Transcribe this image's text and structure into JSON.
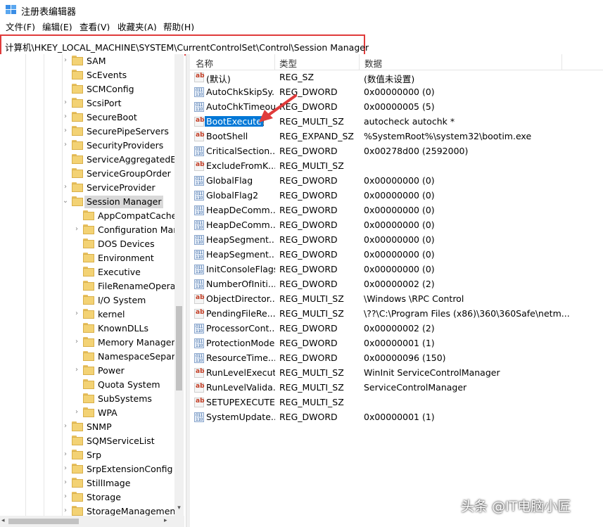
{
  "window": {
    "title": "注册表编辑器",
    "icon": "regedit-icon"
  },
  "menu": [
    {
      "label": "文件(F)"
    },
    {
      "label": "编辑(E)"
    },
    {
      "label": "查看(V)"
    },
    {
      "label": "收藏夹(A)"
    },
    {
      "label": "帮助(H)"
    }
  ],
  "address": {
    "path": "计算机\\HKEY_LOCAL_MACHINE\\SYSTEM\\CurrentControlSet\\Control\\Session Manager",
    "highlight_color": "#e03b3b"
  },
  "tree": {
    "items": [
      {
        "label": "SAM",
        "level": 0,
        "expander": ">"
      },
      {
        "label": "ScEvents",
        "level": 0,
        "expander": ""
      },
      {
        "label": "SCMConfig",
        "level": 0,
        "expander": ""
      },
      {
        "label": "ScsiPort",
        "level": 0,
        "expander": ">"
      },
      {
        "label": "SecureBoot",
        "level": 0,
        "expander": ">"
      },
      {
        "label": "SecurePipeServers",
        "level": 0,
        "expander": ">"
      },
      {
        "label": "SecurityProviders",
        "level": 0,
        "expander": ">"
      },
      {
        "label": "ServiceAggregatedEv",
        "level": 0,
        "expander": ""
      },
      {
        "label": "ServiceGroupOrder",
        "level": 0,
        "expander": ""
      },
      {
        "label": "ServiceProvider",
        "level": 0,
        "expander": ">"
      },
      {
        "label": "Session Manager",
        "level": 0,
        "expander": "v",
        "selected": true
      },
      {
        "label": "AppCompatCache",
        "level": 1,
        "expander": ""
      },
      {
        "label": "Configuration Mar",
        "level": 1,
        "expander": ">"
      },
      {
        "label": "DOS Devices",
        "level": 1,
        "expander": ""
      },
      {
        "label": "Environment",
        "level": 1,
        "expander": ""
      },
      {
        "label": "Executive",
        "level": 1,
        "expander": ""
      },
      {
        "label": "FileRenameOperat",
        "level": 1,
        "expander": ""
      },
      {
        "label": "I/O System",
        "level": 1,
        "expander": ""
      },
      {
        "label": "kernel",
        "level": 1,
        "expander": ">"
      },
      {
        "label": "KnownDLLs",
        "level": 1,
        "expander": ""
      },
      {
        "label": "Memory Managen",
        "level": 1,
        "expander": ">"
      },
      {
        "label": "NamespaceSepara",
        "level": 1,
        "expander": ""
      },
      {
        "label": "Power",
        "level": 1,
        "expander": ">"
      },
      {
        "label": "Quota System",
        "level": 1,
        "expander": ""
      },
      {
        "label": "SubSystems",
        "level": 1,
        "expander": ""
      },
      {
        "label": "WPA",
        "level": 1,
        "expander": ">"
      },
      {
        "label": "SNMP",
        "level": 0,
        "expander": ">"
      },
      {
        "label": "SQMServiceList",
        "level": 0,
        "expander": ""
      },
      {
        "label": "Srp",
        "level": 0,
        "expander": ">"
      },
      {
        "label": "SrpExtensionConfig",
        "level": 0,
        "expander": ">"
      },
      {
        "label": "StillImage",
        "level": 0,
        "expander": ">"
      },
      {
        "label": "Storage",
        "level": 0,
        "expander": ">"
      },
      {
        "label": "StorageManagement",
        "level": 0,
        "expander": ">"
      }
    ]
  },
  "list": {
    "columns": {
      "name": "名称",
      "type": "类型",
      "data": "数据"
    },
    "rows": [
      {
        "name": "(默认)",
        "type": "REG_SZ",
        "data": "(数值未设置)",
        "icon": "sz"
      },
      {
        "name": "AutoChkSkipSy...",
        "type": "REG_DWORD",
        "data": "0x00000000 (0)",
        "icon": "dword"
      },
      {
        "name": "AutoChkTimeout",
        "type": "REG_DWORD",
        "data": "0x00000005 (5)",
        "icon": "dword"
      },
      {
        "name": "BootExecute",
        "type": "REG_MULTI_SZ",
        "data": "autocheck autochk *",
        "icon": "sz",
        "selected": true
      },
      {
        "name": "BootShell",
        "type": "REG_EXPAND_SZ",
        "data": "%SystemRoot%\\system32\\bootim.exe",
        "icon": "sz"
      },
      {
        "name": "CriticalSection...",
        "type": "REG_DWORD",
        "data": "0x00278d00 (2592000)",
        "icon": "dword"
      },
      {
        "name": "ExcludeFromK...",
        "type": "REG_MULTI_SZ",
        "data": "",
        "icon": "sz"
      },
      {
        "name": "GlobalFlag",
        "type": "REG_DWORD",
        "data": "0x00000000 (0)",
        "icon": "dword"
      },
      {
        "name": "GlobalFlag2",
        "type": "REG_DWORD",
        "data": "0x00000000 (0)",
        "icon": "dword"
      },
      {
        "name": "HeapDeComm...",
        "type": "REG_DWORD",
        "data": "0x00000000 (0)",
        "icon": "dword"
      },
      {
        "name": "HeapDeComm...",
        "type": "REG_DWORD",
        "data": "0x00000000 (0)",
        "icon": "dword"
      },
      {
        "name": "HeapSegment...",
        "type": "REG_DWORD",
        "data": "0x00000000 (0)",
        "icon": "dword"
      },
      {
        "name": "HeapSegment...",
        "type": "REG_DWORD",
        "data": "0x00000000 (0)",
        "icon": "dword"
      },
      {
        "name": "InitConsoleFlags",
        "type": "REG_DWORD",
        "data": "0x00000000 (0)",
        "icon": "dword"
      },
      {
        "name": "NumberOfIniti...",
        "type": "REG_DWORD",
        "data": "0x00000002 (2)",
        "icon": "dword"
      },
      {
        "name": "ObjectDirector...",
        "type": "REG_MULTI_SZ",
        "data": "\\Windows \\RPC Control",
        "icon": "sz"
      },
      {
        "name": "PendingFileRe...",
        "type": "REG_MULTI_SZ",
        "data": "\\??\\C:\\Program Files (x86)\\360\\360Safe\\netm...",
        "icon": "sz"
      },
      {
        "name": "ProcessorCont...",
        "type": "REG_DWORD",
        "data": "0x00000002 (2)",
        "icon": "dword"
      },
      {
        "name": "ProtectionMode",
        "type": "REG_DWORD",
        "data": "0x00000001 (1)",
        "icon": "dword"
      },
      {
        "name": "ResourceTime...",
        "type": "REG_DWORD",
        "data": "0x00000096 (150)",
        "icon": "dword"
      },
      {
        "name": "RunLevelExecute",
        "type": "REG_MULTI_SZ",
        "data": "WinInit ServiceControlManager",
        "icon": "sz"
      },
      {
        "name": "RunLevelValida...",
        "type": "REG_MULTI_SZ",
        "data": "ServiceControlManager",
        "icon": "sz"
      },
      {
        "name": "SETUPEXECUTE",
        "type": "REG_MULTI_SZ",
        "data": "",
        "icon": "sz"
      },
      {
        "name": "SystemUpdate...",
        "type": "REG_DWORD",
        "data": "0x00000001 (1)",
        "icon": "dword"
      }
    ]
  },
  "annotation": {
    "arrow_color": "#e03b3b"
  },
  "watermark": {
    "text": "头条 @IT电脑小匠"
  },
  "colors": {
    "selection": "#0078d7",
    "tree_selection": "#d9d9d9",
    "folder": "#f3d274"
  }
}
